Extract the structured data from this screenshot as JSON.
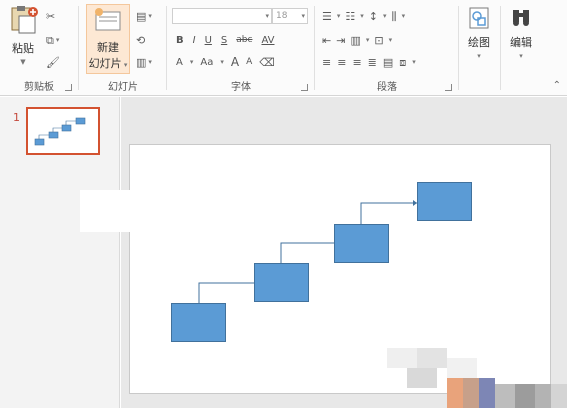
{
  "clipboard": {
    "paste_label": "粘贴",
    "group_label": "剪贴板"
  },
  "slides": {
    "new_slide_label": "新建",
    "new_slide_label2": "幻灯片",
    "group_label": "幻灯片"
  },
  "font": {
    "font_name": "",
    "font_size": "18",
    "bold": "B",
    "italic": "I",
    "underline": "U",
    "shadow": "S",
    "strike": "abc",
    "spacing": "AV",
    "aa": "Aa",
    "grow": "A",
    "shrink": "A",
    "color_a": "A",
    "group_label": "字体"
  },
  "paragraph": {
    "group_label": "段落"
  },
  "drawing": {
    "draw_label": "绘图",
    "edit_label": "编辑"
  },
  "thumbnail": {
    "slide_number": "1"
  },
  "colors": {
    "accent_orange": "#d35230",
    "shape_fill": "#5b9bd5",
    "shape_border": "#41719c",
    "connector": "#41719c"
  }
}
